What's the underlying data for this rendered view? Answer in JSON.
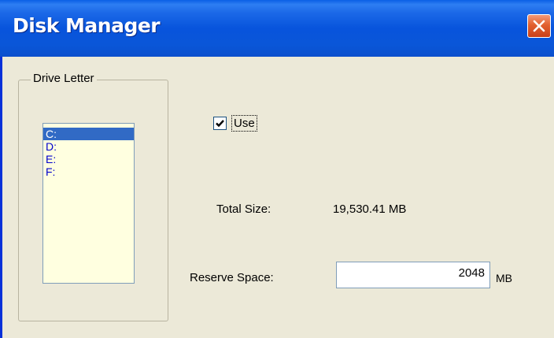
{
  "window": {
    "title": "Disk Manager",
    "close_symbol": "×"
  },
  "drive_group": {
    "label": "Drive Letter",
    "items": [
      {
        "label": "C:",
        "selected": true
      },
      {
        "label": "D:",
        "selected": false
      },
      {
        "label": "E:",
        "selected": false
      },
      {
        "label": "F:",
        "selected": false
      }
    ]
  },
  "use": {
    "label": "Use",
    "checked": true
  },
  "total_size": {
    "label": "Total Size:",
    "value": "19,530.41 MB"
  },
  "reserve_space": {
    "label": "Reserve Space:",
    "value": "2048",
    "unit": "MB"
  },
  "colors": {
    "titlebar": "#0854dc",
    "window_bg": "#ece9d8",
    "list_bg": "#ffffe0",
    "list_selected": "#316ac5",
    "list_text": "#0000cc",
    "close_button": "#e2602f"
  },
  "icons": {
    "close": "close-icon",
    "check": "checkmark-icon"
  }
}
